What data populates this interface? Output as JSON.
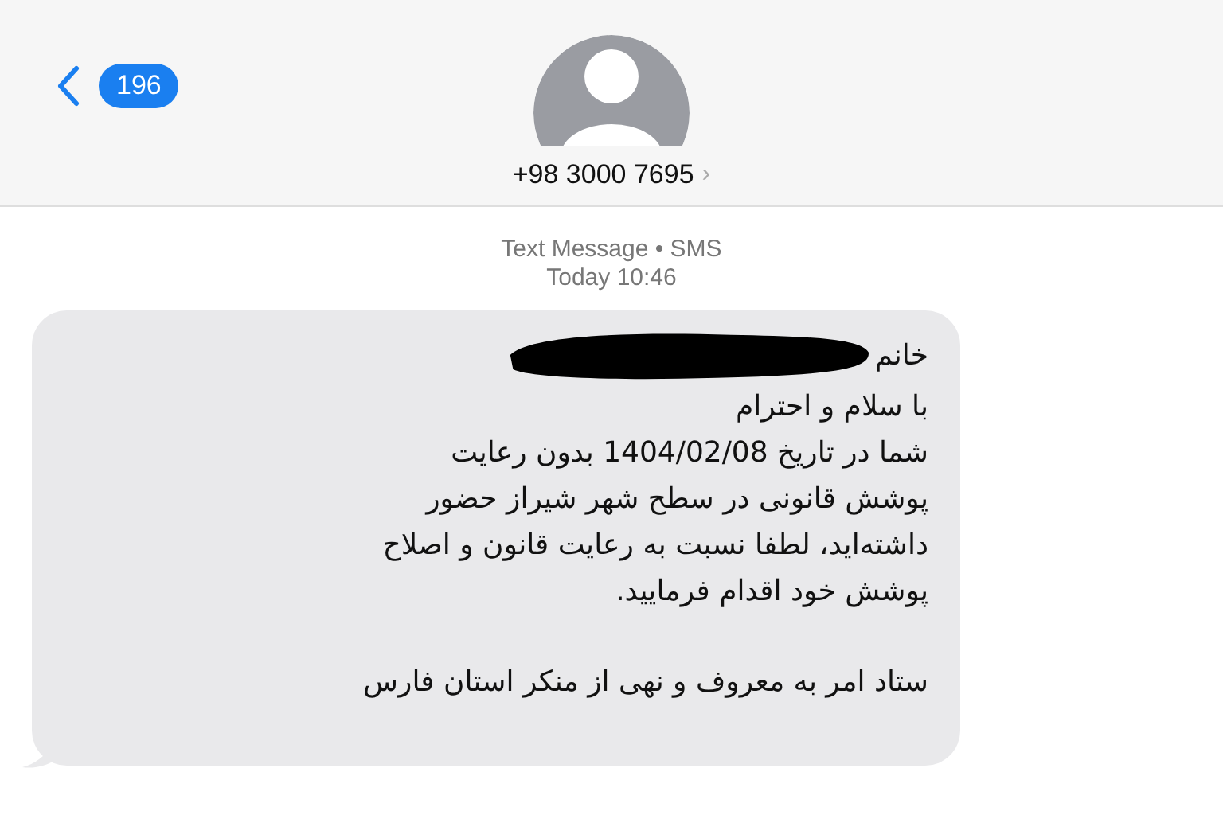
{
  "header": {
    "back_badge": "196",
    "contact": "+98 3000 7695",
    "chevron": "›"
  },
  "thread_info": {
    "label": "Text Message • SMS",
    "time": "Today 10:46"
  },
  "message": {
    "paragraphs": [
      {
        "lines": [
          {
            "text": "خانم",
            "redacted": true
          },
          {
            "text": "با سلام و احترام",
            "redacted": false
          },
          {
            "text": "شما در تاریخ 1404/02/08 بدون رعایت",
            "redacted": false
          },
          {
            "text": "پوشش قانونی در سطح شهر شیراز حضور",
            "redacted": false
          },
          {
            "text": "داشته‌اید، لطفا نسبت به رعایت قانون و اصلاح",
            "redacted": false
          },
          {
            "text": "پوشش خود اقدام فرمایید.",
            "redacted": false
          }
        ]
      },
      {
        "lines": [
          {
            "text": "ستاد امر به معروف و نهی از منکر استان فارس",
            "redacted": false
          }
        ]
      }
    ]
  }
}
